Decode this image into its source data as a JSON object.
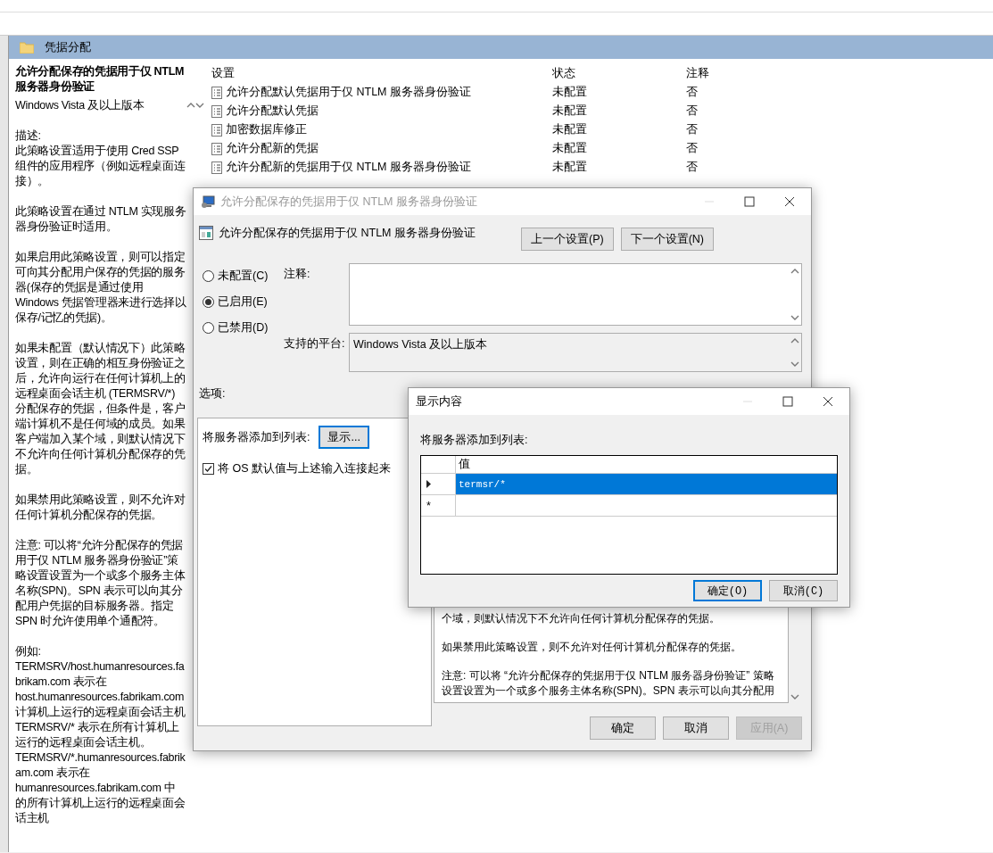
{
  "folder": {
    "title": "凭据分配"
  },
  "description": {
    "title": "允许分配保存的凭据用于仅 NTLM 服务器身份验证",
    "paragraphs": [
      "Windows Vista 及以上版本",
      "描述:\n此策略设置适用于使用 Cred SSP 组件的应用程序（例如远程桌面连接）。",
      "此策略设置在通过 NTLM 实现服务器身份验证时适用。",
      "如果启用此策略设置，则可以指定可向其分配用户保存的凭据的服务器(保存的凭据是通过使用 Windows 凭据管理器来进行选择以保存/记忆的凭据)。",
      "如果未配置（默认情况下）此策略设置，则在正确的相互身份验证之后，允许向运行在任何计算机上的远程桌面会话主机 (TERMSRV/*) 分配保存的凭据，但条件是，客户端计算机不是任何域的成员。如果客户端加入某个域，则默认情况下不允许向任何计算机分配保存的凭据。",
      "如果禁用此策略设置，则不允许对任何计算机分配保存的凭据。",
      "注意: 可以将“允许分配保存的凭据用于仅 NTLM 服务器身份验证”策略设置设置为一个或多个服务主体名称(SPN)。SPN 表示可以向其分配用户凭据的目标服务器。指定 SPN 时允许使用单个通配符。",
      "例如:\nTERMSRV/host.humanresources.fabrikam.com 表示在 host.humanresources.fabrikam.com 计算机上运行的远程桌面会话主机\nTERMSRV/* 表示在所有计算机上运行的远程桌面会话主机。\nTERMSRV/*.humanresources.fabrikam.com 表示在 humanresources.fabrikam.com 中的所有计算机上运行的远程桌面会话主机"
    ]
  },
  "settings_table": {
    "columns": [
      "设置",
      "状态",
      "注释"
    ],
    "rows": [
      {
        "name": "允许分配默认凭据用于仅 NTLM 服务器身份验证",
        "state": "未配置",
        "comment": "否"
      },
      {
        "name": "允许分配默认凭据",
        "state": "未配置",
        "comment": "否"
      },
      {
        "name": "加密数据库修正",
        "state": "未配置",
        "comment": "否"
      },
      {
        "name": "允许分配新的凭据",
        "state": "未配置",
        "comment": "否"
      },
      {
        "name": "允许分配新的凭据用于仅 NTLM 服务器身份验证",
        "state": "未配置",
        "comment": "否"
      }
    ]
  },
  "policy_dialog": {
    "title": "允许分配保存的凭据用于仅 NTLM 服务器身份验证",
    "setting_name": "允许分配保存的凭据用于仅 NTLM 服务器身份验证",
    "nav_buttons": [
      "上一个设置(P)",
      "下一个设置(N)"
    ],
    "radios": [
      {
        "label": "未配置(C)",
        "selected": false
      },
      {
        "label": "已启用(E)",
        "selected": true
      },
      {
        "label": "已禁用(D)",
        "selected": false
      }
    ],
    "comment_label": "注释:",
    "platform_label": "支持的平台:",
    "platform": "Windows Vista 及以上版本",
    "options_label": "选项:",
    "list_label": "将服务器添加到列表:",
    "show_button": "显示...",
    "concat_option": {
      "label": "将 OS 默认值与上述输入连接起来",
      "checked": true
    },
    "help_paragraphs": [
      "个域，则默认情况下不允许向任何计算机分配保存的凭据。",
      "如果禁用此策略设置，则不允许对任何计算机分配保存的凭据。",
      "注意: 可以将 “允许分配保存的凭据用于仅 NTLM 服务器身份验证” 策略设置设置为一个或多个服务主体名称(SPN)。SPN 表示可以向其分配用"
    ],
    "buttons": [
      {
        "label": "确定",
        "disabled": false
      },
      {
        "label": "取消",
        "disabled": false
      },
      {
        "label": "应用(A)",
        "disabled": true
      }
    ]
  },
  "show_dialog": {
    "title": "显示内容",
    "label": "将服务器添加到列表:",
    "column": "值",
    "rows": [
      {
        "value": "termsr/*",
        "selected": true
      }
    ],
    "new_row_marker": "*",
    "buttons": [
      {
        "label": "确定(O)",
        "focused": true
      },
      {
        "label": "取消(C)",
        "focused": false
      }
    ]
  }
}
